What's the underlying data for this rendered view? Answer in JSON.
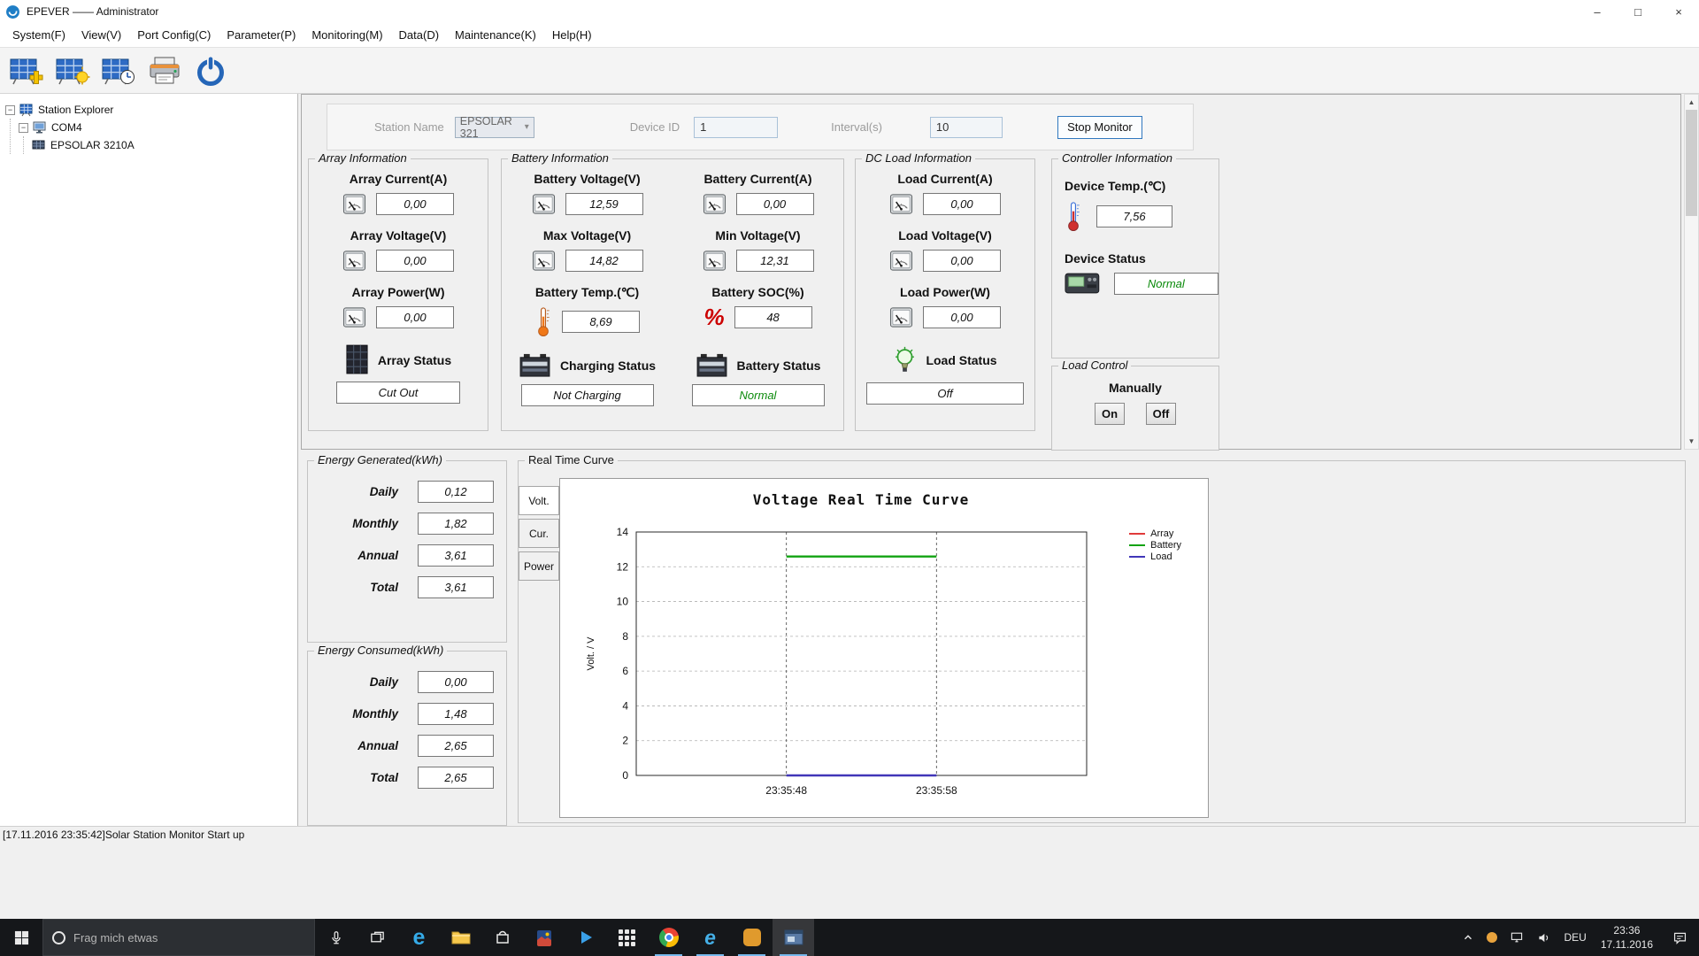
{
  "colors": {
    "accent": "#3077be",
    "status_ok": "#0a8a0a",
    "taskbar_bg": "#15171a"
  },
  "icons": {
    "collapse": "−",
    "dropdown_arrow": "▾",
    "scroll_up": "▲",
    "scroll_down": "▼",
    "minimize": "–",
    "maximize": "□",
    "close": "×",
    "soc": "%",
    "edge": "e",
    "ie": "e"
  },
  "window": {
    "title": "EPEVER —— Administrator"
  },
  "menu": {
    "items": [
      "System(F)",
      "View(V)",
      "Port Config(C)",
      "Parameter(P)",
      "Monitoring(M)",
      "Data(D)",
      "Maintenance(K)",
      "Help(H)"
    ]
  },
  "toolbar": {
    "buttons": [
      "add-station-icon",
      "station-monitor-icon",
      "station-time-icon",
      "print-icon",
      "power-icon"
    ]
  },
  "tree": {
    "root": "Station Explorer",
    "port": "COM4",
    "device": "EPSOLAR 3210A"
  },
  "monitor_bar": {
    "station_name_label": "Station Name",
    "station_name_value": "EPSOLAR 321",
    "device_id_label": "Device ID",
    "device_id_value": "1",
    "interval_label": "Interval(s)",
    "interval_value": "10",
    "stop_button": "Stop Monitor"
  },
  "groups": {
    "array": {
      "title": "Array Information",
      "current_label": "Array Current(A)",
      "current": "0,00",
      "voltage_label": "Array Voltage(V)",
      "voltage": "0,00",
      "power_label": "Array Power(W)",
      "power": "0,00",
      "status_label": "Array Status",
      "status": "Cut Out"
    },
    "battery": {
      "title": "Battery Information",
      "voltage_label": "Battery Voltage(V)",
      "voltage": "12,59",
      "current_label": "Battery Current(A)",
      "current": "0,00",
      "max_label": "Max Voltage(V)",
      "max": "14,82",
      "min_label": "Min Voltage(V)",
      "min": "12,31",
      "temp_label": "Battery Temp.(℃)",
      "temp": "8,69",
      "soc_label": "Battery SOC(%)",
      "soc": "48",
      "charging_label": "Charging Status",
      "charging": "Not Charging",
      "status_label": "Battery Status",
      "status": "Normal"
    },
    "load": {
      "title": "DC Load Information",
      "current_label": "Load Current(A)",
      "current": "0,00",
      "voltage_label": "Load Voltage(V)",
      "voltage": "0,00",
      "power_label": "Load Power(W)",
      "power": "0,00",
      "status_label": "Load Status",
      "status": "Off"
    },
    "controller": {
      "title": "Controller Information",
      "temp_label": "Device Temp.(℃)",
      "temp": "7,56",
      "status_label": "Device Status",
      "status": "Normal"
    },
    "load_control": {
      "title": "Load Control",
      "manually_label": "Manually",
      "on": "On",
      "off": "Off"
    }
  },
  "energy_generated": {
    "title": "Energy Generated(kWh)",
    "rows": [
      {
        "label": "Daily",
        "value": "0,12"
      },
      {
        "label": "Monthly",
        "value": "1,82"
      },
      {
        "label": "Annual",
        "value": "3,61"
      },
      {
        "label": "Total",
        "value": "3,61"
      }
    ]
  },
  "energy_consumed": {
    "title": "Energy Consumed(kWh)",
    "rows": [
      {
        "label": "Daily",
        "value": "0,00"
      },
      {
        "label": "Monthly",
        "value": "1,48"
      },
      {
        "label": "Annual",
        "value": "2,65"
      },
      {
        "label": "Total",
        "value": "2,65"
      }
    ]
  },
  "curve_panel": {
    "title": "Real Time Curve",
    "tabs": [
      "Volt.",
      "Cur.",
      "Power"
    ]
  },
  "chart_data": {
    "type": "line",
    "title": "Voltage Real Time Curve",
    "ylabel": "Volt. / V",
    "ylim": [
      0,
      14
    ],
    "yticks": [
      0,
      2,
      4,
      6,
      8,
      10,
      12,
      14
    ],
    "xticks": [
      "23:35:48",
      "23:35:58"
    ],
    "grid": "dashed",
    "legend_position": "right",
    "series": [
      {
        "name": "Array",
        "color": "#e03a3a",
        "points": []
      },
      {
        "name": "Battery",
        "color": "#12a312",
        "points": [
          {
            "x": "23:35:48",
            "y": 12.59
          },
          {
            "x": "23:35:58",
            "y": 12.59
          }
        ]
      },
      {
        "name": "Load",
        "color": "#4136b8",
        "points": [
          {
            "x": "23:35:48",
            "y": 0
          },
          {
            "x": "23:35:58",
            "y": 0
          }
        ]
      }
    ]
  },
  "status_bar": {
    "text": "[17.11.2016 23:35:42]Solar Station Monitor Start up"
  },
  "taskbar": {
    "search_placeholder": "Frag mich etwas",
    "language": "DEU",
    "time": "23:36",
    "date": "17.11.2016"
  }
}
